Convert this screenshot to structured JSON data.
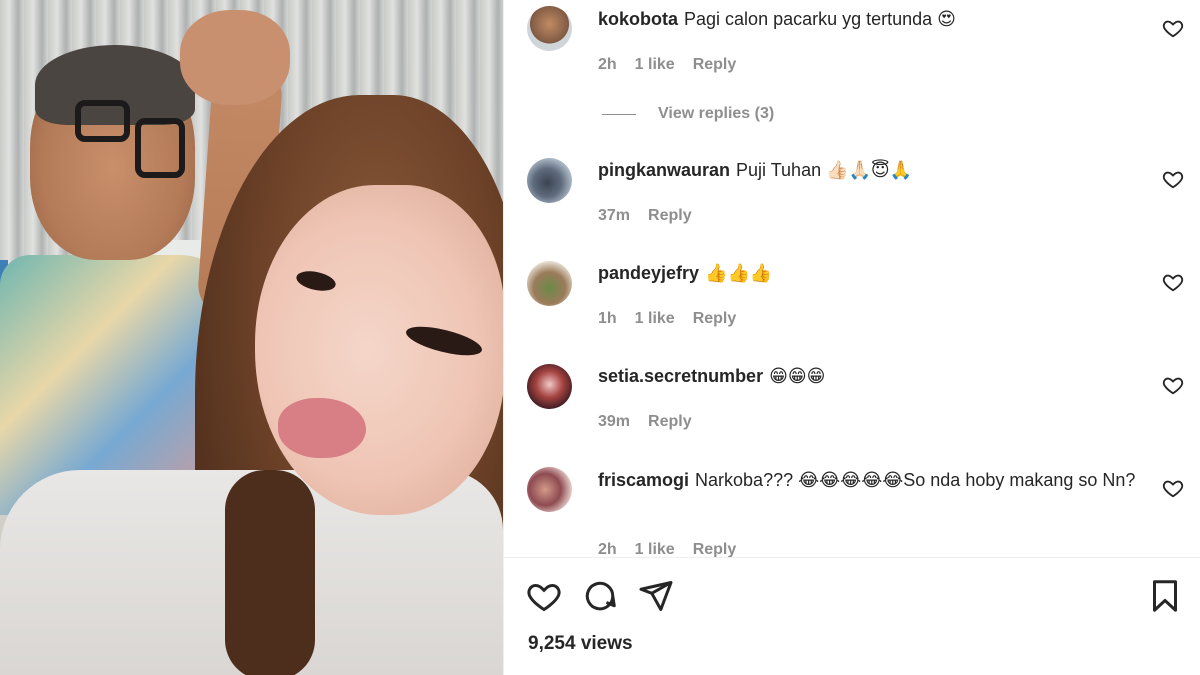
{
  "comments": [
    {
      "username": "kokobota",
      "text": "Pagi calon pacarku yg tertunda 😍",
      "time": "2h",
      "likes": "1 like",
      "reply": "Reply",
      "avatar": "avatar-kokobota",
      "view_replies": "View replies (3)"
    },
    {
      "username": "pingkanwauran",
      "text": "Puji Tuhan 👍🏻🙏🏻😇🙏",
      "time": "37m",
      "likes": "",
      "reply": "Reply",
      "avatar": "avatar-pingkanwauran"
    },
    {
      "username": "pandeyjefry",
      "text": "👍👍👍",
      "time": "1h",
      "likes": "1 like",
      "reply": "Reply",
      "avatar": "avatar-pandeyjefry"
    },
    {
      "username": "setia.secretnumber",
      "text": "😁😁😁",
      "time": "39m",
      "likes": "",
      "reply": "Reply",
      "avatar": "avatar-setia"
    },
    {
      "username": "friscamogi",
      "text": "Narkoba??? 😂😂😂😂😂So nda hoby makang so Nn?",
      "time": "2h",
      "likes": "1 like",
      "reply": "Reply",
      "avatar": "avatar-friscamogi"
    }
  ],
  "actions": {
    "like_icon": "heart-icon",
    "comment_icon": "comment-icon",
    "share_icon": "share-icon",
    "save_icon": "bookmark-icon"
  },
  "post": {
    "views": "9,254 views"
  },
  "colors": {
    "text": "#262626",
    "secondary": "#8e8e8e",
    "divider": "#efefef",
    "accent": "#3f7fb7"
  }
}
